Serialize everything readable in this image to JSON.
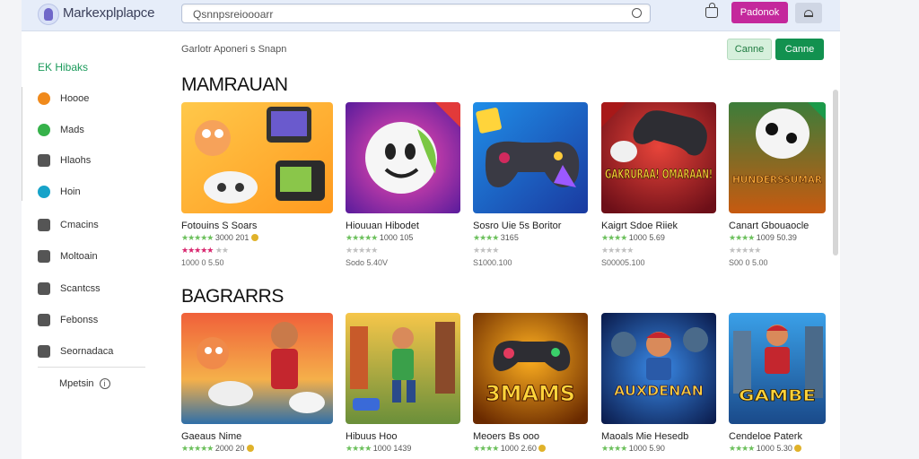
{
  "header": {
    "brand": "Markexplplapce",
    "search_value": "Qsnnpsreioooarr",
    "button_label": "Padonok"
  },
  "sidebar": {
    "heading": "EK  Hibaks",
    "items": [
      {
        "label": "Hoooe",
        "icon": "home-icon"
      },
      {
        "label": "Mads",
        "icon": "mods-icon"
      },
      {
        "label": "Hlaohs",
        "icon": "games-icon"
      },
      {
        "label": "Hoin",
        "icon": "play-icon"
      },
      {
        "label": "Cmacins",
        "icon": "chat-icon"
      },
      {
        "label": "Moltoain",
        "icon": "message-icon"
      },
      {
        "label": "Scantcss",
        "icon": "tools-icon"
      },
      {
        "label": "Febonss",
        "icon": "gift-icon"
      },
      {
        "label": "Seornadaca",
        "icon": "controller-icon"
      }
    ],
    "footer": "Mpetsin"
  },
  "main": {
    "breadcrumb": "Garlotr  Aponeri s Snapn",
    "btn_outline": "Canne",
    "btn_primary": "Canne",
    "sections": [
      {
        "title": "MAMRAUAN",
        "cards": [
          {
            "title": "Fotouins S Soars",
            "rating": "3000 201",
            "meta": "",
            "price": "1000 0 5.50",
            "theme": "yellow"
          },
          {
            "title": "Hiouuan Hibodet",
            "rating": "1000 105",
            "meta": "S   ",
            "price": "Sodo 5.40V",
            "theme": "purple"
          },
          {
            "title": "Sosro Uie 5s Boritor",
            "rating": "3165",
            "meta": "",
            "price": "S1000.100",
            "theme": "blue"
          },
          {
            "title": "Kaigrt Sdoe Riiek",
            "rating": "1000 5.69",
            "meta": "",
            "price": "S00005.100",
            "theme": "red"
          },
          {
            "title": "Canart Gbouaocle",
            "rating": "1009 50.39",
            "meta": "",
            "price": "S00 0 5.00",
            "theme": "orange"
          }
        ]
      },
      {
        "title": "BAGRARRS",
        "cards": [
          {
            "title": "Gaeaus Nime",
            "rating": "2000 20",
            "price": "",
            "theme": "sunset"
          },
          {
            "title": "Hibuus Hoo",
            "rating": "1000 1439",
            "price": "",
            "theme": "street"
          },
          {
            "title": "Meoers  Bs ooo",
            "rating": "1000 2.60",
            "price": "",
            "theme": "gold"
          },
          {
            "title": "Maoals Mie Hesedb",
            "rating": "1000 5.90",
            "price": "",
            "theme": "night"
          },
          {
            "title": "Cendeloe Paterk",
            "rating": "1000 5.30",
            "price": "",
            "theme": "city"
          }
        ]
      }
    ]
  },
  "colors": {
    "accent_pink": "#c4289c",
    "accent_green": "#12914f",
    "sidebar_heading": "#1a9a5a"
  },
  "art_texts": {
    "r1c4": "GAKRURAA! OMARAAN!",
    "r1c5": "HUNDERSSUMAR",
    "r2c3": "3MAMS",
    "r2c4": "AUXDENAN",
    "r2c5": "GAMBE"
  }
}
